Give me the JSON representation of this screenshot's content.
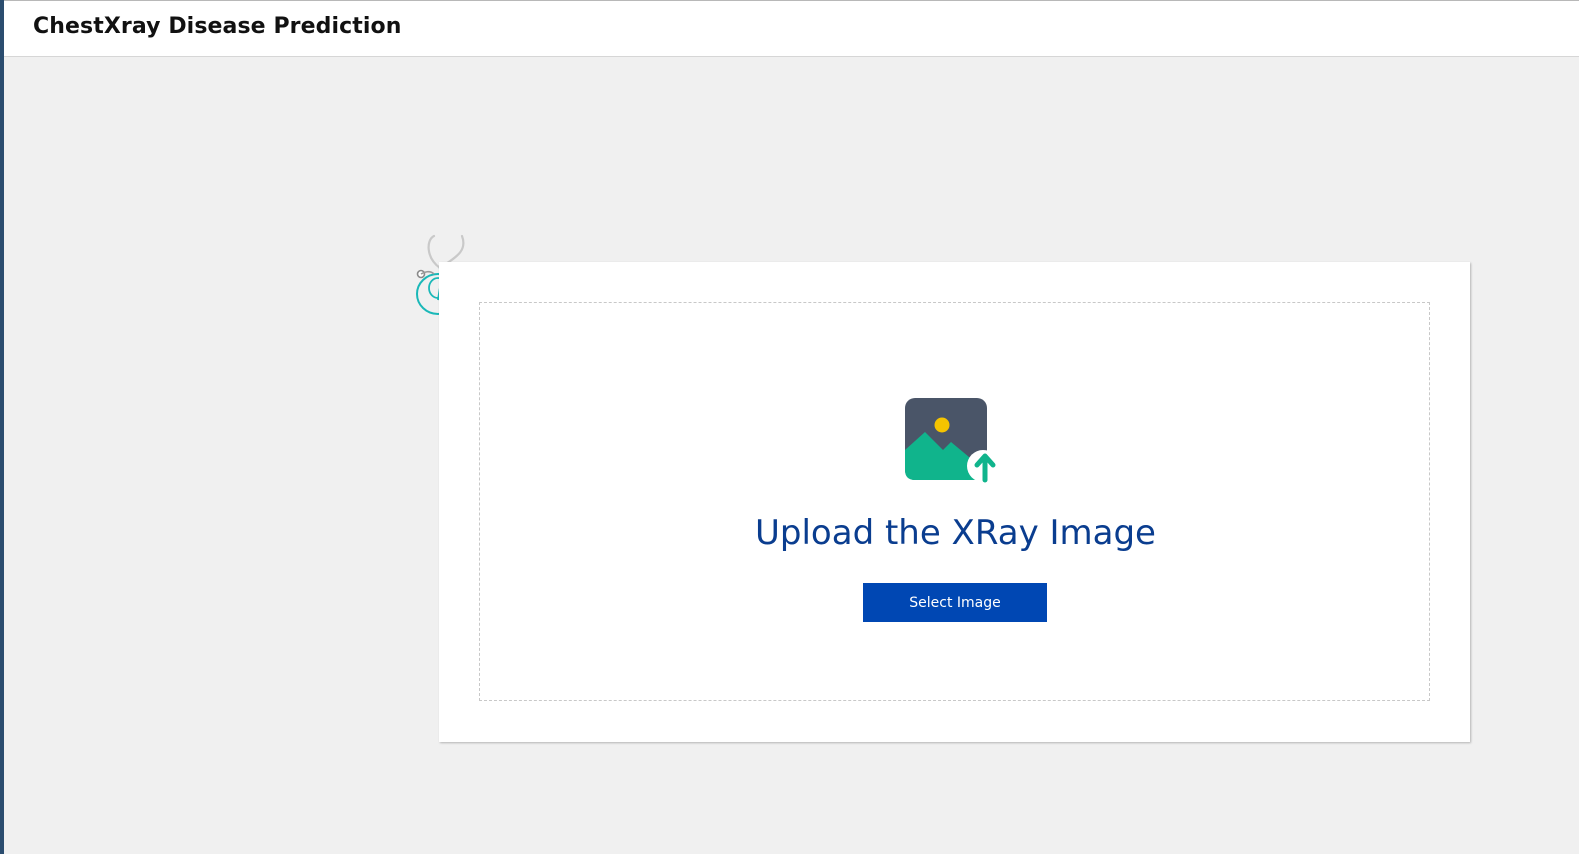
{
  "header": {
    "title": "ChestXray Disease Prediction"
  },
  "upload": {
    "heading": "Upload the XRay Image",
    "button_label": "Select Image",
    "icon": "image-upload-icon"
  },
  "decor": {
    "icon": "stethoscope-icon"
  },
  "colors": {
    "header_bg": "#ffffff",
    "page_bg": "#f0f0f0",
    "accent_stripe": "#2b4d6f",
    "heading_text": "#0a3d8f",
    "button_bg": "#0047b3",
    "icon_frame": "#4a5568",
    "icon_mountain": "#10b48c",
    "icon_sun": "#f5c400",
    "stethoscope": "#1ab8b8"
  }
}
